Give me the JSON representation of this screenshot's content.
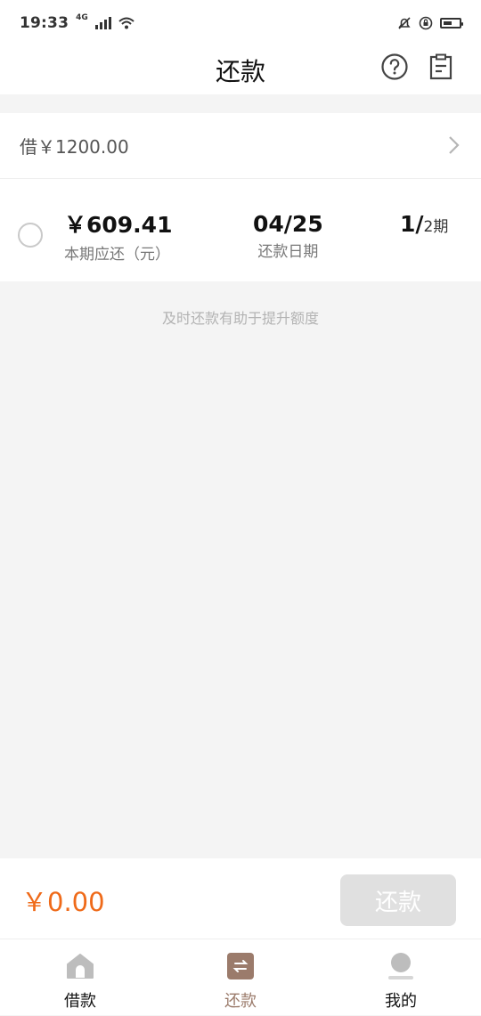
{
  "status_bar": {
    "time": "19:33",
    "network_label": "4G"
  },
  "header": {
    "title": "还款"
  },
  "loan_summary": {
    "text": "借￥1200.00"
  },
  "installment": {
    "amount": "￥609.41",
    "amount_label": "本期应还（元）",
    "date": "04/25",
    "date_label": "还款日期",
    "period_current": "1/",
    "period_total": "2期"
  },
  "hint": "及时还款有助于提升额度",
  "payment": {
    "total": "￥0.00",
    "button_label": "还款"
  },
  "tabs": [
    {
      "label": "借款",
      "icon": "home-icon"
    },
    {
      "label": "还款",
      "icon": "repay-icon"
    },
    {
      "label": "我的",
      "icon": "profile-icon"
    }
  ],
  "colors": {
    "accent_orange": "#ef6a19",
    "active_tab": "#9b7b6b",
    "disabled_button": "#e0e0e0"
  }
}
